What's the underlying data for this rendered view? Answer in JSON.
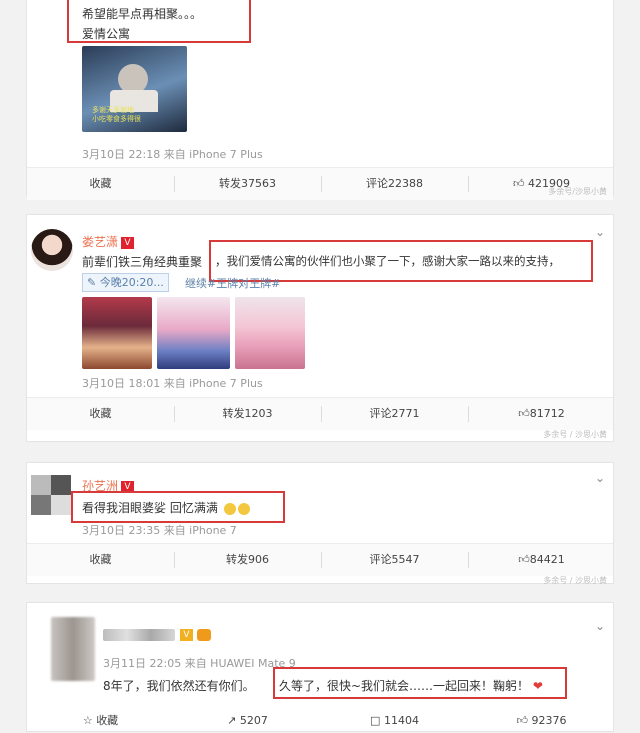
{
  "post1": {
    "text_line1": "希望能早点再相聚。。。",
    "text_line2": "爱情公寓",
    "thumb_caption": "多谢天多谢地\n小吃零食多得很",
    "meta": "3月10日 22:18 来自 iPhone 7 Plus",
    "actions": {
      "fav": "收藏",
      "repost": "转发37563",
      "comment": "评论22388",
      "like": "421909"
    },
    "watermark": "多余号/沙思小黄"
  },
  "post2": {
    "name": "娄艺潇",
    "badge": "V",
    "text_start": "前辈们铁三角经典重聚",
    "text_highlight": "，我们爱情公寓的伙伴们也小聚了一下，感谢大家一路以来的支持，",
    "link_chip": "今晚20:20...",
    "link_text": "继续#王牌对王牌#",
    "meta": "3月10日 18:01 来自 iPhone 7 Plus",
    "actions": {
      "fav": "收藏",
      "repost": "转发1203",
      "comment": "评论2771",
      "like": "81712"
    },
    "watermark": "多余号 / 沙思小黄"
  },
  "post3": {
    "name": "孙艺洲",
    "badge": "V",
    "text": "看得我泪眼婆娑 回忆满满",
    "meta": "3月10日 23:35 来自 iPhone 7",
    "actions": {
      "fav": "收藏",
      "repost": "转发906",
      "comment": "评论5547",
      "like": "84421"
    },
    "watermark": "多余号 / 沙思小黄"
  },
  "post4": {
    "badge": "V",
    "meta": "3月11日 22:05 来自 HUAWEI Mate 9",
    "text_start": "8年了，我们依然还有你们。",
    "text_highlight": "久等了，很快~我们就会……一起回来！鞠躬！",
    "actions": {
      "fav": "收藏",
      "repost": "5207",
      "comment": "11404",
      "like": "92376"
    }
  },
  "colors": {
    "highlight_box": "#d83a3a",
    "name_orange": "#eb7350",
    "badge_red": "#e0222e"
  },
  "icons": [
    "star-icon",
    "share-icon",
    "comment-icon",
    "thumbs-up-icon",
    "chevron-down-icon",
    "heart-icon",
    "crown-icon",
    "link-icon",
    "emoji-tears-icon"
  ]
}
